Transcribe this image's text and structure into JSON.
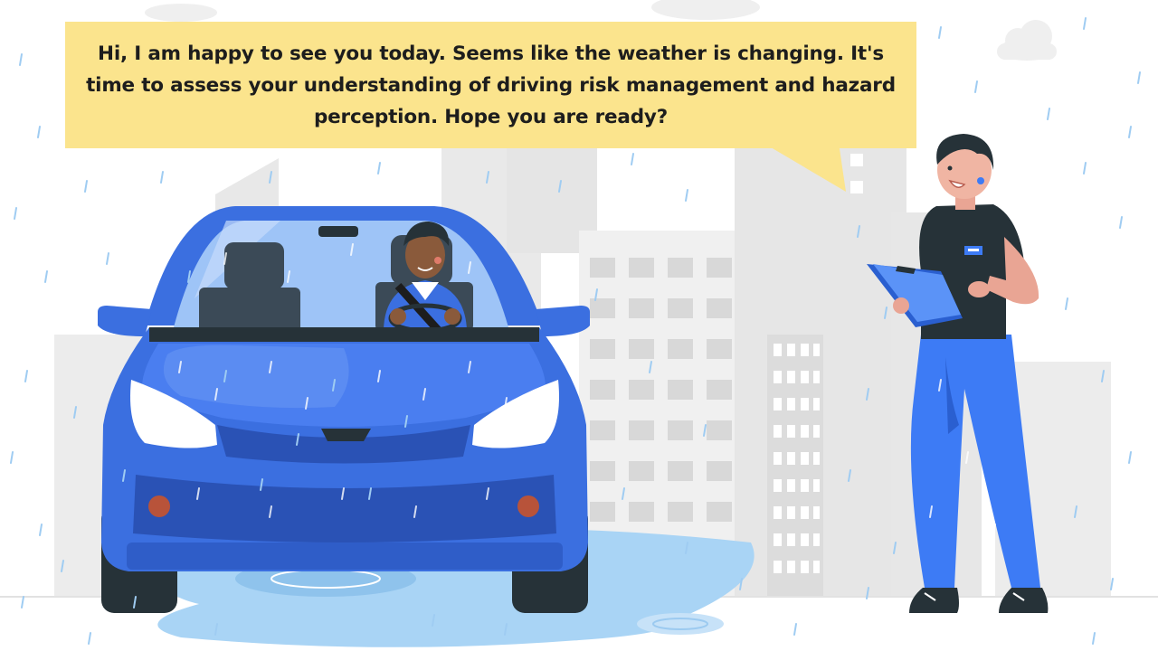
{
  "slide": {
    "speech_text": "Hi, I am happy to see you today. Seems like the weather is changing. It's time to assess your understanding of driving risk management and hazard perception. Hope you are ready?"
  },
  "colors": {
    "bubble": "#fbe48d",
    "car_body": "#3b6fe0",
    "car_dark": "#2a52b5",
    "puddle": "#a9d4f5",
    "building": "#e6e6e6",
    "instructor_shirt": "#263238",
    "instructor_pants": "#3d7bf5"
  },
  "icons": {
    "clouds": "cloud-icon",
    "rain": "rain-icon"
  }
}
